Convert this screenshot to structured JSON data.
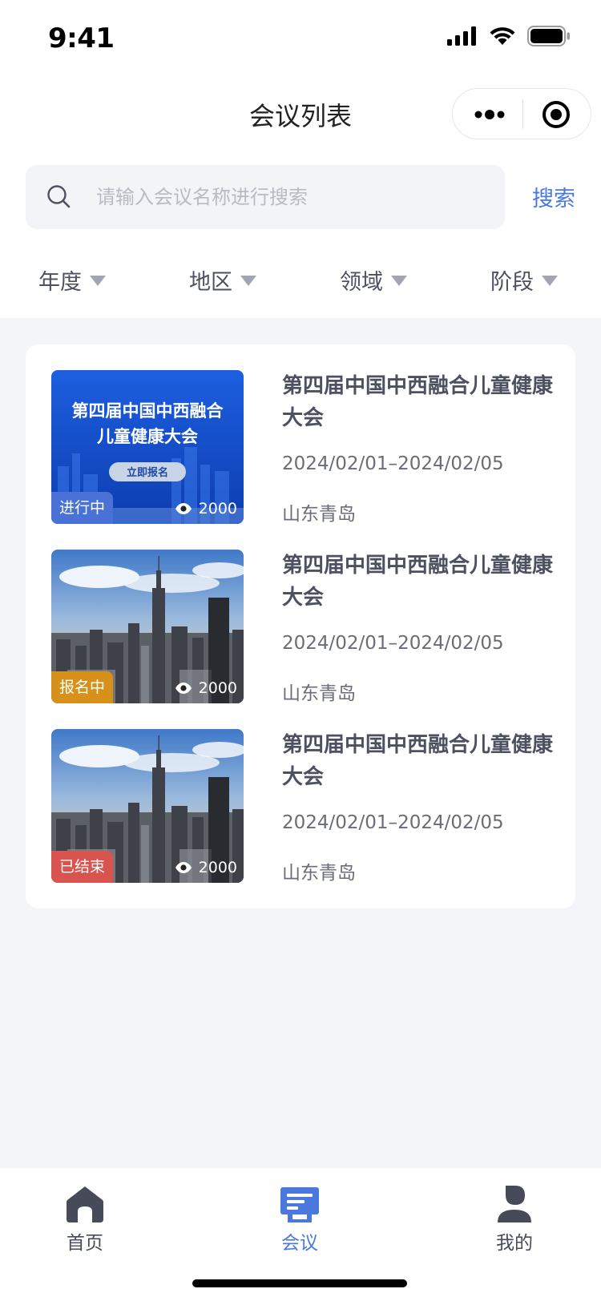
{
  "status_bar": {
    "time": "9:41"
  },
  "nav": {
    "title": "会议列表"
  },
  "search": {
    "placeholder": "请输入会议名称进行搜索",
    "value": "",
    "button_label": "搜索"
  },
  "filters": [
    {
      "label": "年度"
    },
    {
      "label": "地区"
    },
    {
      "label": "领域"
    },
    {
      "label": "阶段"
    }
  ],
  "conferences": [
    {
      "title": "第四届中国中西融合儿童健康大会",
      "date": "2024/02/01–2024/02/05",
      "location": "山东青岛",
      "status": "进行中",
      "status_color": "#4a72d6",
      "views": "2000",
      "banner_line1": "第四届中国中西融合",
      "banner_line2": "儿童健康大会",
      "banner_button": "立即报名"
    },
    {
      "title": "第四届中国中西融合儿童健康大会",
      "date": "2024/02/01–2024/02/05",
      "location": "山东青岛",
      "status": "报名中",
      "status_color": "#d7901a",
      "views": "2000"
    },
    {
      "title": "第四届中国中西融合儿童健康大会",
      "date": "2024/02/01–2024/02/05",
      "location": "山东青岛",
      "status": "已结束",
      "status_color": "#d9534f",
      "views": "2000"
    }
  ],
  "tabbar": {
    "items": [
      {
        "label": "首页",
        "icon": "home-icon"
      },
      {
        "label": "会议",
        "icon": "meeting-icon",
        "active": true
      },
      {
        "label": "我的",
        "icon": "profile-icon"
      }
    ],
    "active_color": "#4a78dc"
  }
}
